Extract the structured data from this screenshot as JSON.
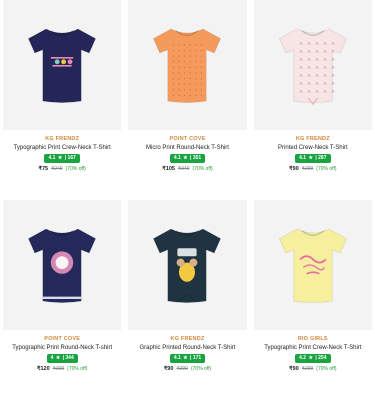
{
  "products": [
    {
      "brand": "KG FRENDZ",
      "title": "Typographic Print Crew-Neck T-Shirt",
      "rating": "4.1",
      "reviews": "167",
      "price": "₹75",
      "mrp": "₹249",
      "discount": "(70% off)",
      "tshirt": {
        "body": "#232657",
        "sleeve": "#232657",
        "graphic": "paris",
        "accent": "#f1f1f1"
      }
    },
    {
      "brand": "POINT COVE",
      "title": "Micro Print Round-Neck T-Shirt",
      "rating": "4.1",
      "reviews": "351",
      "price": "₹105",
      "mrp": "₹349",
      "discount": "(70% off)",
      "tshirt": {
        "body": "#f59a5d",
        "sleeve": "#f59a5d",
        "graphic": "dots",
        "accent": "#e2773a"
      }
    },
    {
      "brand": "KG FRENDZ",
      "title": "Printed Crew-Neck T-Shirt",
      "rating": "4.1",
      "reviews": "287",
      "price": "₹90",
      "mrp": "₹299",
      "discount": "(70% off)",
      "tshirt": {
        "body": "#f7e4e4",
        "sleeve": "#f7e4e4",
        "graphic": "floral",
        "accent": "#e6b3b8"
      }
    },
    {
      "brand": "POINT COVE",
      "title": "Typographic Print Round-Neck T-shirt",
      "rating": "4",
      "reviews": "344",
      "price": "₹120",
      "mrp": "₹399",
      "discount": "(70% off)",
      "tshirt": {
        "body": "#24285a",
        "sleeve": "#24285a",
        "graphic": "badge",
        "accent": "#f39ac4"
      }
    },
    {
      "brand": "KG FRENDZ",
      "title": "Graphic Printed Round-Neck T-Shirt",
      "rating": "4.1",
      "reviews": "171",
      "price": "₹90",
      "mrp": "₹299",
      "discount": "(70% off)",
      "tshirt": {
        "body": "#1f3340",
        "sleeve": "#1f3340",
        "graphic": "mouse",
        "accent": "#f3c93f"
      }
    },
    {
      "brand": "RIO GIRLS",
      "title": "Typographic Print Crew-Neck T-Shirt",
      "rating": "4.2",
      "reviews": "254",
      "price": "₹90",
      "mrp": "₹299",
      "discount": "(70% off)",
      "tshirt": {
        "body": "#f5ef9e",
        "sleeve": "#f5ef9e",
        "graphic": "script",
        "accent": "#e96aa3"
      }
    }
  ]
}
